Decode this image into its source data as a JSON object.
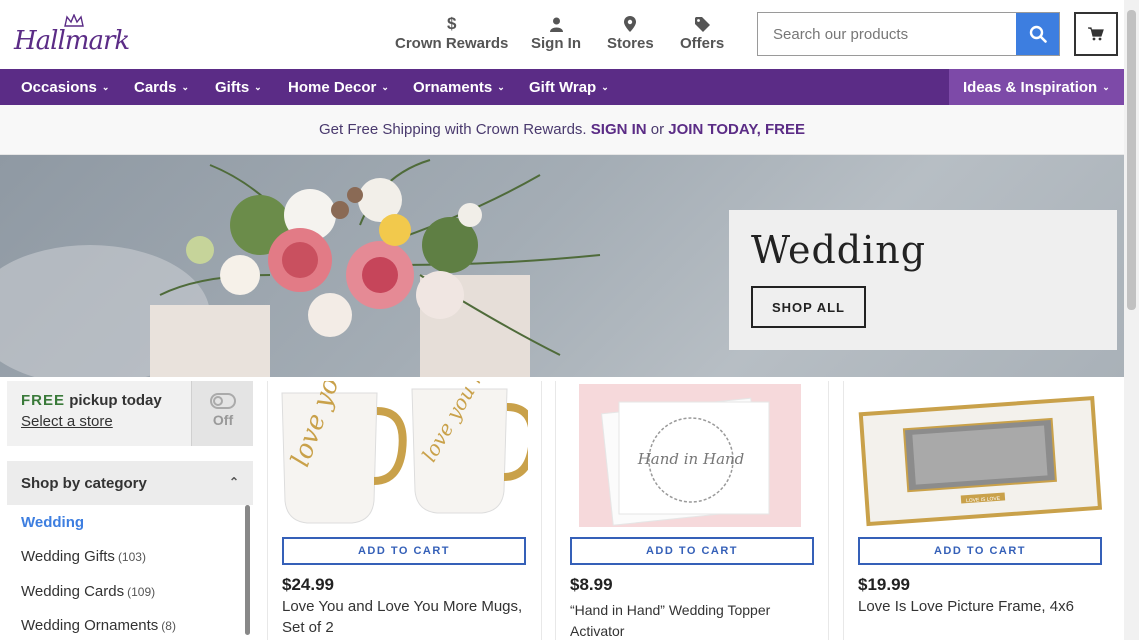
{
  "brand": {
    "logo_text": "Hallmark"
  },
  "header_nav": [
    {
      "label": "Crown Rewards",
      "icon": "dollar-icon"
    },
    {
      "label": "Sign In",
      "icon": "user-icon"
    },
    {
      "label": "Stores",
      "icon": "location-pin-icon"
    },
    {
      "label": "Offers",
      "icon": "tag-icon"
    }
  ],
  "search": {
    "placeholder": "Search our products"
  },
  "main_nav": [
    {
      "label": "Occasions"
    },
    {
      "label": "Cards"
    },
    {
      "label": "Gifts"
    },
    {
      "label": "Home Decor"
    },
    {
      "label": "Ornaments"
    },
    {
      "label": "Gift Wrap"
    }
  ],
  "ideas_nav": {
    "label": "Ideas & Inspiration"
  },
  "promo": {
    "text": "Get Free Shipping with Crown Rewards.",
    "sign_in": "SIGN IN",
    "or": "or",
    "join": "JOIN TODAY, FREE"
  },
  "hero": {
    "title": "Wedding",
    "button": "SHOP ALL"
  },
  "pickup": {
    "free": "FREE",
    "today": "pickup today",
    "link": "Select a store",
    "toggle_label": "Off"
  },
  "categories": {
    "heading": "Shop by category",
    "items": [
      {
        "label": "Wedding",
        "count": ""
      },
      {
        "label": "Wedding Gifts",
        "count": "(103)"
      },
      {
        "label": "Wedding Cards",
        "count": "(109)"
      },
      {
        "label": "Wedding Ornaments",
        "count": "(8)"
      }
    ]
  },
  "products": [
    {
      "price": "$24.99",
      "name_line1": "Love You and Love You More Mugs,",
      "name_line2": "Set of 2",
      "cta": "ADD TO CART"
    },
    {
      "price": "$8.99",
      "name_line1": "“Hand in Hand” Wedding Topper Activator",
      "name_line2": "",
      "cta": "ADD TO CART"
    },
    {
      "price": "$19.99",
      "name_line1": "Love Is Love Picture Frame, 4x6",
      "name_line2": "",
      "cta": "ADD TO CART"
    }
  ],
  "product_images": {
    "mug1_text": "love you",
    "mug2_text": "love you more",
    "card_text": "Hand in Hand",
    "frame_plate": "LOVE IS LOVE"
  },
  "colors": {
    "brand_purple": "#5b2c86",
    "accent_blue": "#3d7ee0",
    "ideas_purple": "#7d4aa8"
  }
}
